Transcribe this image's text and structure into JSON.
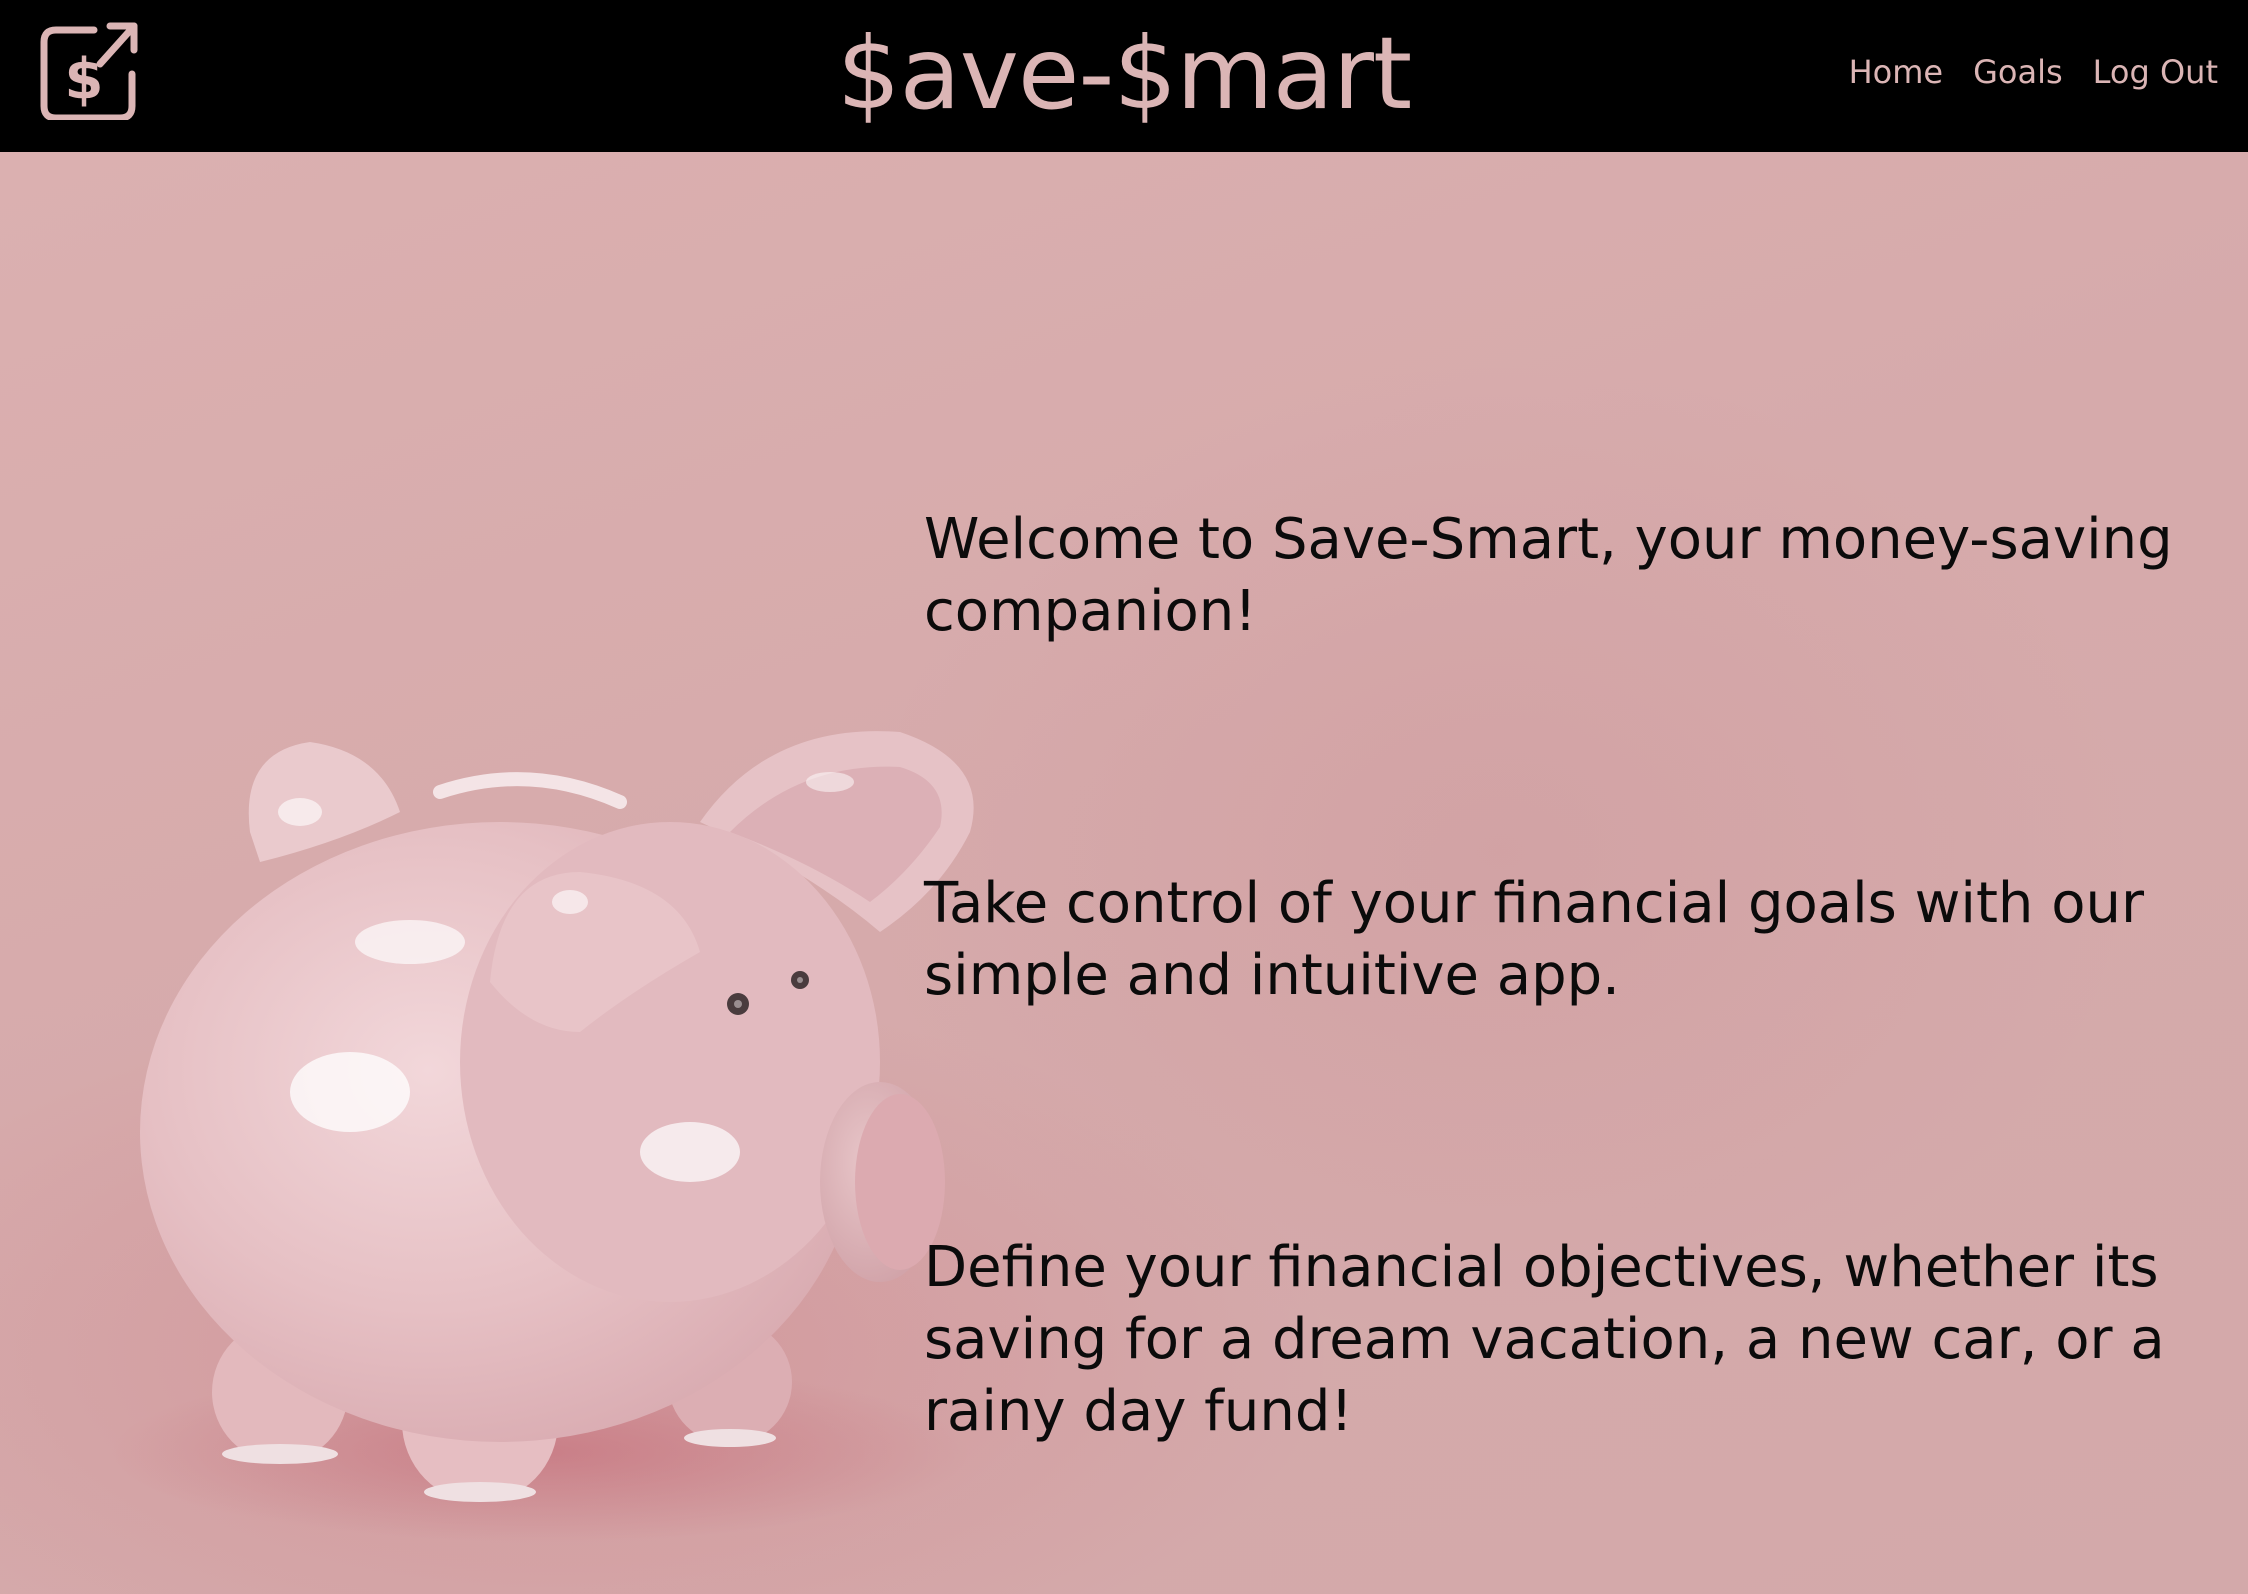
{
  "header": {
    "brand": "$ave-$mart",
    "logo_icon": "dollar-export-icon",
    "nav": [
      {
        "label": "Home"
      },
      {
        "label": "Goals"
      },
      {
        "label": "Log Out"
      }
    ]
  },
  "hero": {
    "image": "piggy-bank-illustration",
    "paragraphs": [
      "Welcome to Save-Smart, your money-saving companion!",
      "Take control of your financial goals with our simple and intuitive app.",
      "Define your financial objectives, whether its saving for a dream vacation, a new car, or a rainy day fund!"
    ]
  },
  "colors": {
    "header_bg": "#000000",
    "accent_pink": "#dbb5b5",
    "background_pink": "#d5adad",
    "text": "#0b0b0b"
  }
}
